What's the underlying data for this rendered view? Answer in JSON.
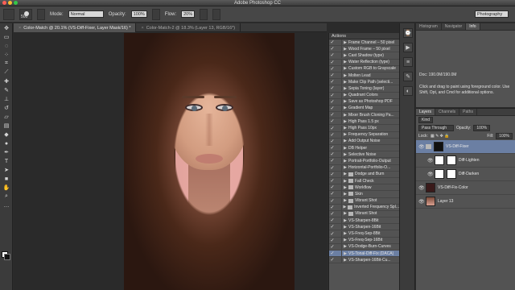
{
  "window": {
    "title": "Adobe Photoshop CC",
    "light_colors": [
      "#fc5f57",
      "#fdbc2e",
      "#34c749"
    ]
  },
  "options": {
    "brush_size": "500",
    "mode_label": "Mode:",
    "mode_value": "Normal",
    "opacity_label": "Opacity:",
    "opacity_value": "100%",
    "flow_label": "Flow:",
    "flow_value": "20%",
    "workspace": "Photography"
  },
  "doc_tabs": [
    {
      "label": "Color-Match @ 20.1% (VS-Diff-Fixer, Layer Mask/16) *"
    },
    {
      "label": "Color-Match-2 @ 18.3% (Layer 13, RGB/16*)"
    }
  ],
  "actions": {
    "header": "Actions",
    "items": [
      "Frame Channel – 50 pixel",
      "Wood Frame – 50 pixel",
      "Cast Shadow (type)",
      "Water Reflection (type)",
      "Custom RGB to Grayscale",
      "Molten Lead",
      "Make Clip Path (selecti...",
      "Sepia Toning (layer)",
      "Quadrant Colors",
      "Save as Photoshop PDF",
      "Gradient Map",
      "Mixer Brush Cloning Pa...",
      "High Pass 1.5 px",
      "High Pass 10px",
      "Frequency Separation",
      "Add Output Noise",
      "DB Helper",
      "Selective Noise",
      "Portrait-Portfolio-Output",
      "Horizontal-Portfolio-O...",
      "Dodge and Burn",
      "Fall Check",
      "Workflow",
      "Skin",
      "Vibrant Shot",
      "Inverted Frequency Spl...",
      "Vibrant Shot",
      "VS-Sharpen-8Bit",
      "VS-Sharpen-16Bit",
      "VS-Freq-Sep-8Bit",
      "VS-Freq-Sep-16Bit",
      "VS-Dodge-Burn-Curves",
      "VS-Tonal-Diff-Fix (DACA)",
      "VS-Sharpen-16Bit-Cu..."
    ],
    "folder_indices": [
      20,
      21,
      22,
      23,
      24,
      25,
      26
    ],
    "selected_index": 32
  },
  "info_panel": {
    "tabs": [
      "Histogram",
      "Navigator",
      "Info"
    ],
    "doc_line": "Doc: 190.0M/190.0M",
    "hint": "Click and drag to paint using foreground color. Use Shift, Opt, and Cmd for additional options."
  },
  "layers_panel": {
    "tabs": [
      "Layers",
      "Channels",
      "Paths"
    ],
    "kind": "Kind",
    "blend_mode": "Pass Through",
    "opacity_label": "Opacity:",
    "opacity_value": "100%",
    "lock_label": "Lock:",
    "fill_label": "Fill:",
    "fill_value": "100%",
    "layers": [
      {
        "name": "VS-Diff-Fixer",
        "selected": true
      },
      {
        "name": "Diff-Lighten",
        "selected": false
      },
      {
        "name": "Diff-Darken",
        "selected": false
      },
      {
        "name": "VS-Diff-Fix-Color",
        "selected": false
      },
      {
        "name": "Layer 13",
        "selected": false
      }
    ]
  }
}
